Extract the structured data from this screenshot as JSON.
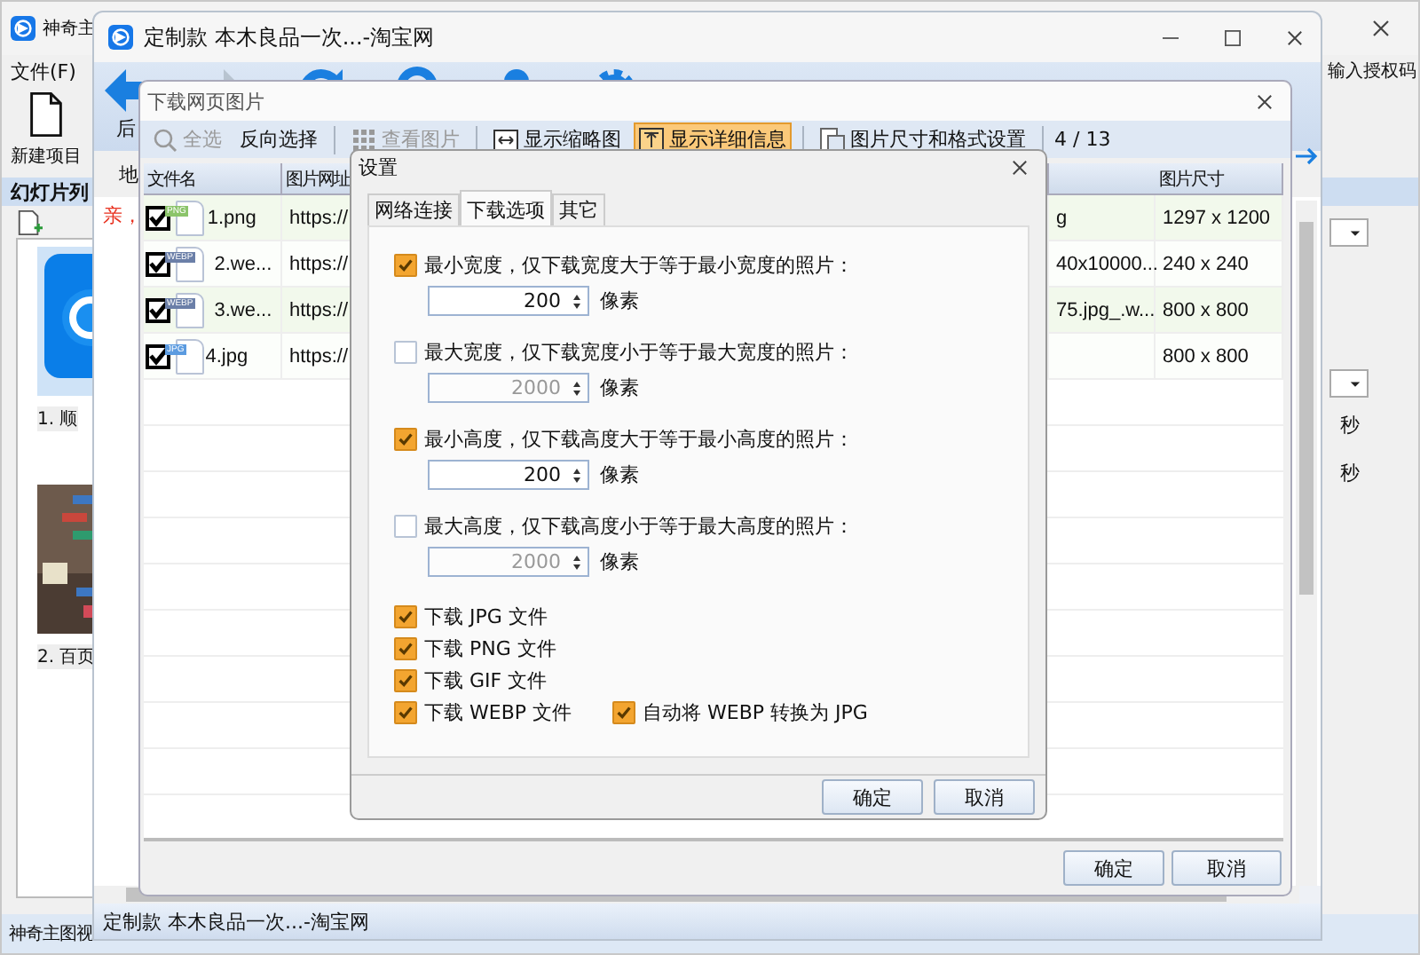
{
  "main_window": {
    "title": "神奇主",
    "menu": [
      "文件(F)"
    ],
    "license_link": "输入授权码",
    "new_project": "新建项目",
    "slide_list_title": "幻灯片列",
    "slides": [
      {
        "label": "1. 顺",
        "kind": "app"
      },
      {
        "label": "2. 百页"
      }
    ],
    "units": [
      "秒",
      "秒"
    ],
    "status": "神奇主图视"
  },
  "browser_window": {
    "title": "定制款 本木良品一次...-淘宝网",
    "back_label": "后",
    "address_label": "地",
    "notice": "亲，",
    "status": "定制款 本木良品一次...-淘宝网"
  },
  "download_window": {
    "title": "下载网页图片",
    "toolbar": [
      {
        "kind": "search",
        "label": "全选",
        "disabled": true,
        "selected": false
      },
      {
        "kind": "plain",
        "label": "反向选择",
        "disabled": false,
        "selected": false
      },
      {
        "kind": "grid",
        "label": "查看图片",
        "disabled": true,
        "selected": false
      },
      {
        "kind": "thumbs",
        "label": "显示缩略图",
        "disabled": false,
        "selected": false
      },
      {
        "kind": "details",
        "label": "显示详细信息",
        "disabled": false,
        "selected": true
      },
      {
        "kind": "format",
        "label": "图片尺寸和格式设置",
        "disabled": false,
        "selected": false
      }
    ],
    "counter": "4 / 13",
    "columns": [
      "文件名",
      "图片网址",
      "图片尺寸"
    ],
    "rows": [
      {
        "checked": true,
        "badge": "PNG",
        "color": "#8bc46a",
        "name": "1.png",
        "url": "https://",
        "column_3": "g",
        "size": "1297 x 1200"
      },
      {
        "checked": true,
        "badge": "WEBP",
        "color": "#6b7fa8",
        "name": "2.we...",
        "url": "https://",
        "column_3": "40x10000...",
        "size": "240 x 240"
      },
      {
        "checked": true,
        "badge": "WEBP",
        "color": "#6b7fa8",
        "name": "3.we...",
        "url": "https://",
        "column_3": "75.jpg_.w...",
        "size": "800 x 800"
      },
      {
        "checked": true,
        "badge": "JPG",
        "color": "#5b9be0",
        "name": "4.jpg",
        "url": "https://",
        "size": "800 x 800"
      }
    ],
    "buttons": [
      "确定",
      "取消"
    ]
  },
  "settings_dialog": {
    "title": "设置",
    "tabs": [
      {
        "label": "网络连接",
        "selected": false
      },
      {
        "label": "下载选项",
        "selected": true
      },
      {
        "label": "其它",
        "selected": false
      }
    ],
    "limits": [
      {
        "checked": true,
        "label": "最小宽度，仅下载宽度大于等于最小宽度的照片：",
        "value": "200",
        "unit": "像素"
      },
      {
        "checked": false,
        "label": "最大宽度，仅下载宽度小于等于最大宽度的照片：",
        "value": "2000",
        "unit": "像素"
      },
      {
        "checked": true,
        "label": "最小高度，仅下载高度大于等于最小高度的照片：",
        "value": "200",
        "unit": "像素"
      },
      {
        "checked": false,
        "label": "最大高度，仅下载高度小于等于最大高度的照片：",
        "value": "2000",
        "unit": "像素"
      }
    ],
    "formats": [
      {
        "checked": true,
        "label": "下载 JPG 文件"
      },
      {
        "checked": true,
        "label": "下载 PNG 文件"
      },
      {
        "checked": true,
        "label": "下载 GIF 文件"
      },
      {
        "checked": true,
        "label": "下载 WEBP 文件"
      }
    ],
    "convert": {
      "checked": true,
      "label": "自动将 WEBP 转换为 JPG"
    },
    "buttons": [
      "确定",
      "取消"
    ]
  }
}
